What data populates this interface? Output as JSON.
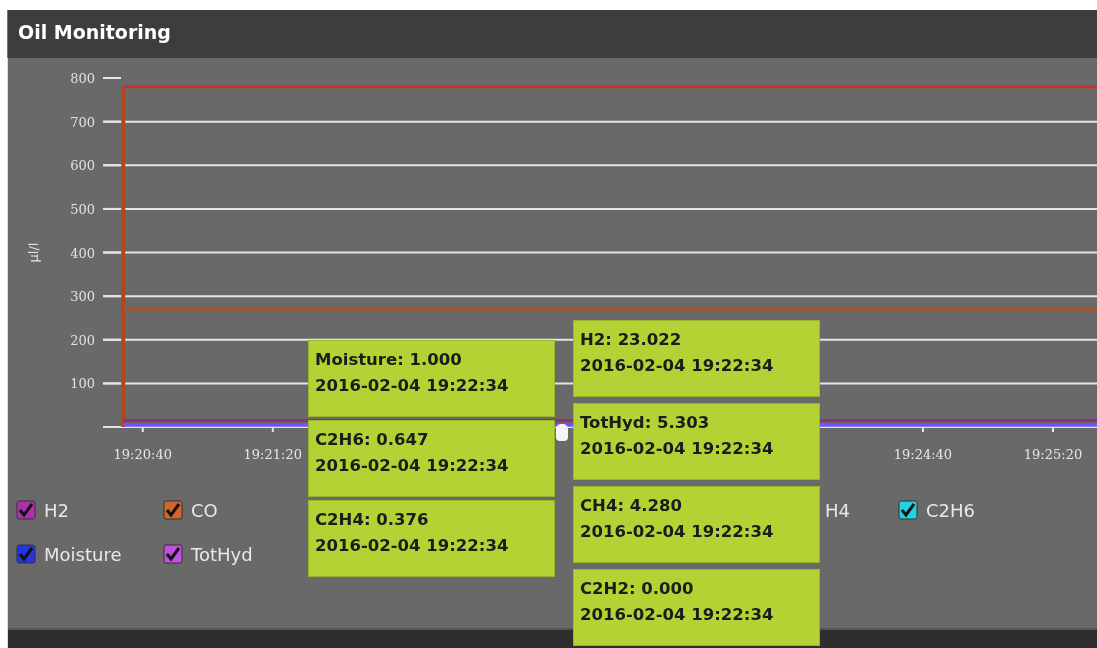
{
  "window": {
    "title": "Oil Monitoring"
  },
  "chart": {
    "chart_data": {
      "type": "line",
      "ylabel": "μl/l",
      "ylim": [
        0,
        800
      ],
      "yticks": [
        100,
        200,
        300,
        400,
        500,
        600,
        700,
        800
      ],
      "xlim": [
        69633,
        69936
      ],
      "xticks": [
        {
          "value": 69640,
          "label": "19:20:40"
        },
        {
          "value": 69680,
          "label": "19:21:20"
        },
        {
          "value": 69880,
          "label": "19:24:40"
        },
        {
          "value": 69920,
          "label": "19:25:20"
        }
      ],
      "grid": true,
      "ref_lines": [
        {
          "axis": "x",
          "value": 69634,
          "color": "#b4461f"
        }
      ],
      "x": [
        69634,
        69936
      ],
      "series": [
        {
          "color": "#c8302a",
          "values": [
            780,
            780
          ]
        },
        {
          "color": "#a8542c",
          "values": [
            270,
            270
          ]
        },
        {
          "color": "#9a2a86",
          "values": [
            15,
            15
          ]
        },
        {
          "color": "#6a55ff",
          "values": [
            4,
            4
          ]
        }
      ]
    }
  },
  "legend": [
    [
      {
        "kind": "entry",
        "label": "H2",
        "checked": true,
        "color": "#b02fb0"
      },
      {
        "kind": "entry",
        "label": "CO",
        "checked": true,
        "color": "#d0662e"
      },
      {
        "kind": "partial",
        "label": "H4"
      },
      {
        "kind": "entry",
        "label": "C2H6",
        "checked": true,
        "color": "#22d2e0"
      }
    ],
    [
      {
        "kind": "entry",
        "label": "Moisture",
        "checked": true,
        "color": "#2234e6"
      },
      {
        "kind": "entry",
        "label": "TotHyd",
        "checked": true,
        "color": "#c24ee2"
      }
    ]
  ],
  "tooltips_left": [
    {
      "label": "Moisture: 1.000",
      "time": "2016-02-04 19:22:34"
    },
    {
      "label": "C2H6: 0.647",
      "time": "2016-02-04 19:22:34"
    },
    {
      "label": "C2H4: 0.376",
      "time": "2016-02-04 19:22:34"
    }
  ],
  "tooltips_right": [
    {
      "label": "H2: 23.022",
      "time": "2016-02-04 19:22:34"
    },
    {
      "label": "TotHyd: 5.303",
      "time": "2016-02-04 19:22:34"
    },
    {
      "label": "CH4: 4.280",
      "time": "2016-02-04 19:22:34"
    },
    {
      "label": "C2H2: 0.000",
      "time": "2016-02-04 19:22:34"
    }
  ]
}
